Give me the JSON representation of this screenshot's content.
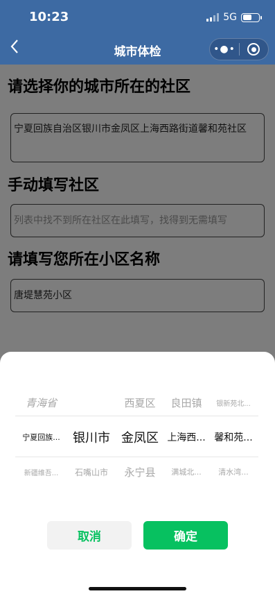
{
  "status": {
    "time": "10:23",
    "network": "5G"
  },
  "nav": {
    "title": "城市体检",
    "more": "•●•"
  },
  "sections": [
    {
      "heading": "请选择你的城市所在的社区",
      "value": "宁夏回族自治区银川市金凤区上海西路街道馨和苑社区"
    },
    {
      "heading": "手动填写社区",
      "placeholder": "列表中找不到所在社区在此填写，找得到无需填写"
    },
    {
      "heading": "请填写您所在小区名称",
      "value": "唐堤慧苑小区"
    }
  ],
  "picker": {
    "above": [
      "青海省",
      "",
      "西夏区",
      "良田镇",
      "银新苑北..."
    ],
    "selected": [
      "宁夏回族...",
      "银川市",
      "金凤区",
      "上海西...",
      "馨和苑..."
    ],
    "below": [
      "新疆维吾...",
      "石嘴山市",
      "永宁县",
      "满城北...",
      "清水湾..."
    ]
  },
  "buttons": {
    "cancel": "取消",
    "confirm": "确定"
  },
  "colors": {
    "header": "#3d6aa3",
    "confirm": "#07c160",
    "cancel_text": "#07c160"
  }
}
